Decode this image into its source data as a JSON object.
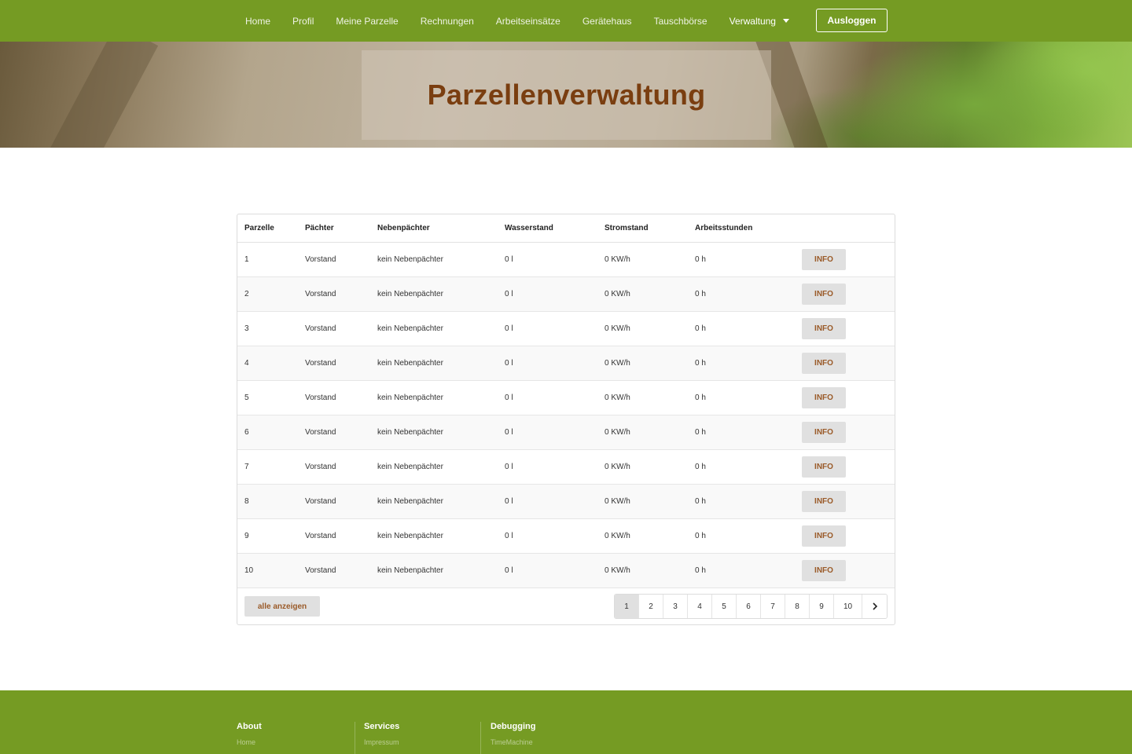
{
  "nav": {
    "items": [
      {
        "label": "Home"
      },
      {
        "label": "Profil"
      },
      {
        "label": "Meine Parzelle"
      },
      {
        "label": "Rechnungen"
      },
      {
        "label": "Arbeitseinsätze"
      },
      {
        "label": "Gerätehaus"
      },
      {
        "label": "Tauschbörse"
      },
      {
        "label": "Verwaltung"
      }
    ],
    "logout_label": "Ausloggen"
  },
  "hero": {
    "title": "Parzellenverwaltung"
  },
  "table": {
    "headers": [
      "Parzelle",
      "Pächter",
      "Nebenpächter",
      "Wasserstand",
      "Stromstand",
      "Arbeitsstunden"
    ],
    "info_label": "INFO",
    "rows": [
      {
        "parzelle": "1",
        "paechter": "Vorstand",
        "nebenpaechter": "kein Nebenpächter",
        "wasser": "0 l",
        "strom": "0 KW/h",
        "arbeit": "0 h"
      },
      {
        "parzelle": "2",
        "paechter": "Vorstand",
        "nebenpaechter": "kein Nebenpächter",
        "wasser": "0 l",
        "strom": "0 KW/h",
        "arbeit": "0 h"
      },
      {
        "parzelle": "3",
        "paechter": "Vorstand",
        "nebenpaechter": "kein Nebenpächter",
        "wasser": "0 l",
        "strom": "0 KW/h",
        "arbeit": "0 h"
      },
      {
        "parzelle": "4",
        "paechter": "Vorstand",
        "nebenpaechter": "kein Nebenpächter",
        "wasser": "0 l",
        "strom": "0 KW/h",
        "arbeit": "0 h"
      },
      {
        "parzelle": "5",
        "paechter": "Vorstand",
        "nebenpaechter": "kein Nebenpächter",
        "wasser": "0 l",
        "strom": "0 KW/h",
        "arbeit": "0 h"
      },
      {
        "parzelle": "6",
        "paechter": "Vorstand",
        "nebenpaechter": "kein Nebenpächter",
        "wasser": "0 l",
        "strom": "0 KW/h",
        "arbeit": "0 h"
      },
      {
        "parzelle": "7",
        "paechter": "Vorstand",
        "nebenpaechter": "kein Nebenpächter",
        "wasser": "0 l",
        "strom": "0 KW/h",
        "arbeit": "0 h"
      },
      {
        "parzelle": "8",
        "paechter": "Vorstand",
        "nebenpaechter": "kein Nebenpächter",
        "wasser": "0 l",
        "strom": "0 KW/h",
        "arbeit": "0 h"
      },
      {
        "parzelle": "9",
        "paechter": "Vorstand",
        "nebenpaechter": "kein Nebenpächter",
        "wasser": "0 l",
        "strom": "0 KW/h",
        "arbeit": "0 h"
      },
      {
        "parzelle": "10",
        "paechter": "Vorstand",
        "nebenpaechter": "kein Nebenpächter",
        "wasser": "0 l",
        "strom": "0 KW/h",
        "arbeit": "0 h"
      }
    ],
    "show_all_label": "alle anzeigen",
    "pagination": {
      "current": "1",
      "pages": [
        "1",
        "2",
        "3",
        "4",
        "5",
        "6",
        "7",
        "8",
        "9",
        "10"
      ],
      "next_icon": "chevron-right-icon"
    }
  },
  "footer": {
    "columns": [
      {
        "heading": "About",
        "link": "Home"
      },
      {
        "heading": "Services",
        "link": "Impressum"
      },
      {
        "heading": "Debugging",
        "link": "TimeMachine"
      }
    ]
  },
  "colors": {
    "brand_green": "#759b23",
    "title_brown": "#7a3e10",
    "button_text": "#9a5a28",
    "button_bg": "#e0e0e0"
  }
}
